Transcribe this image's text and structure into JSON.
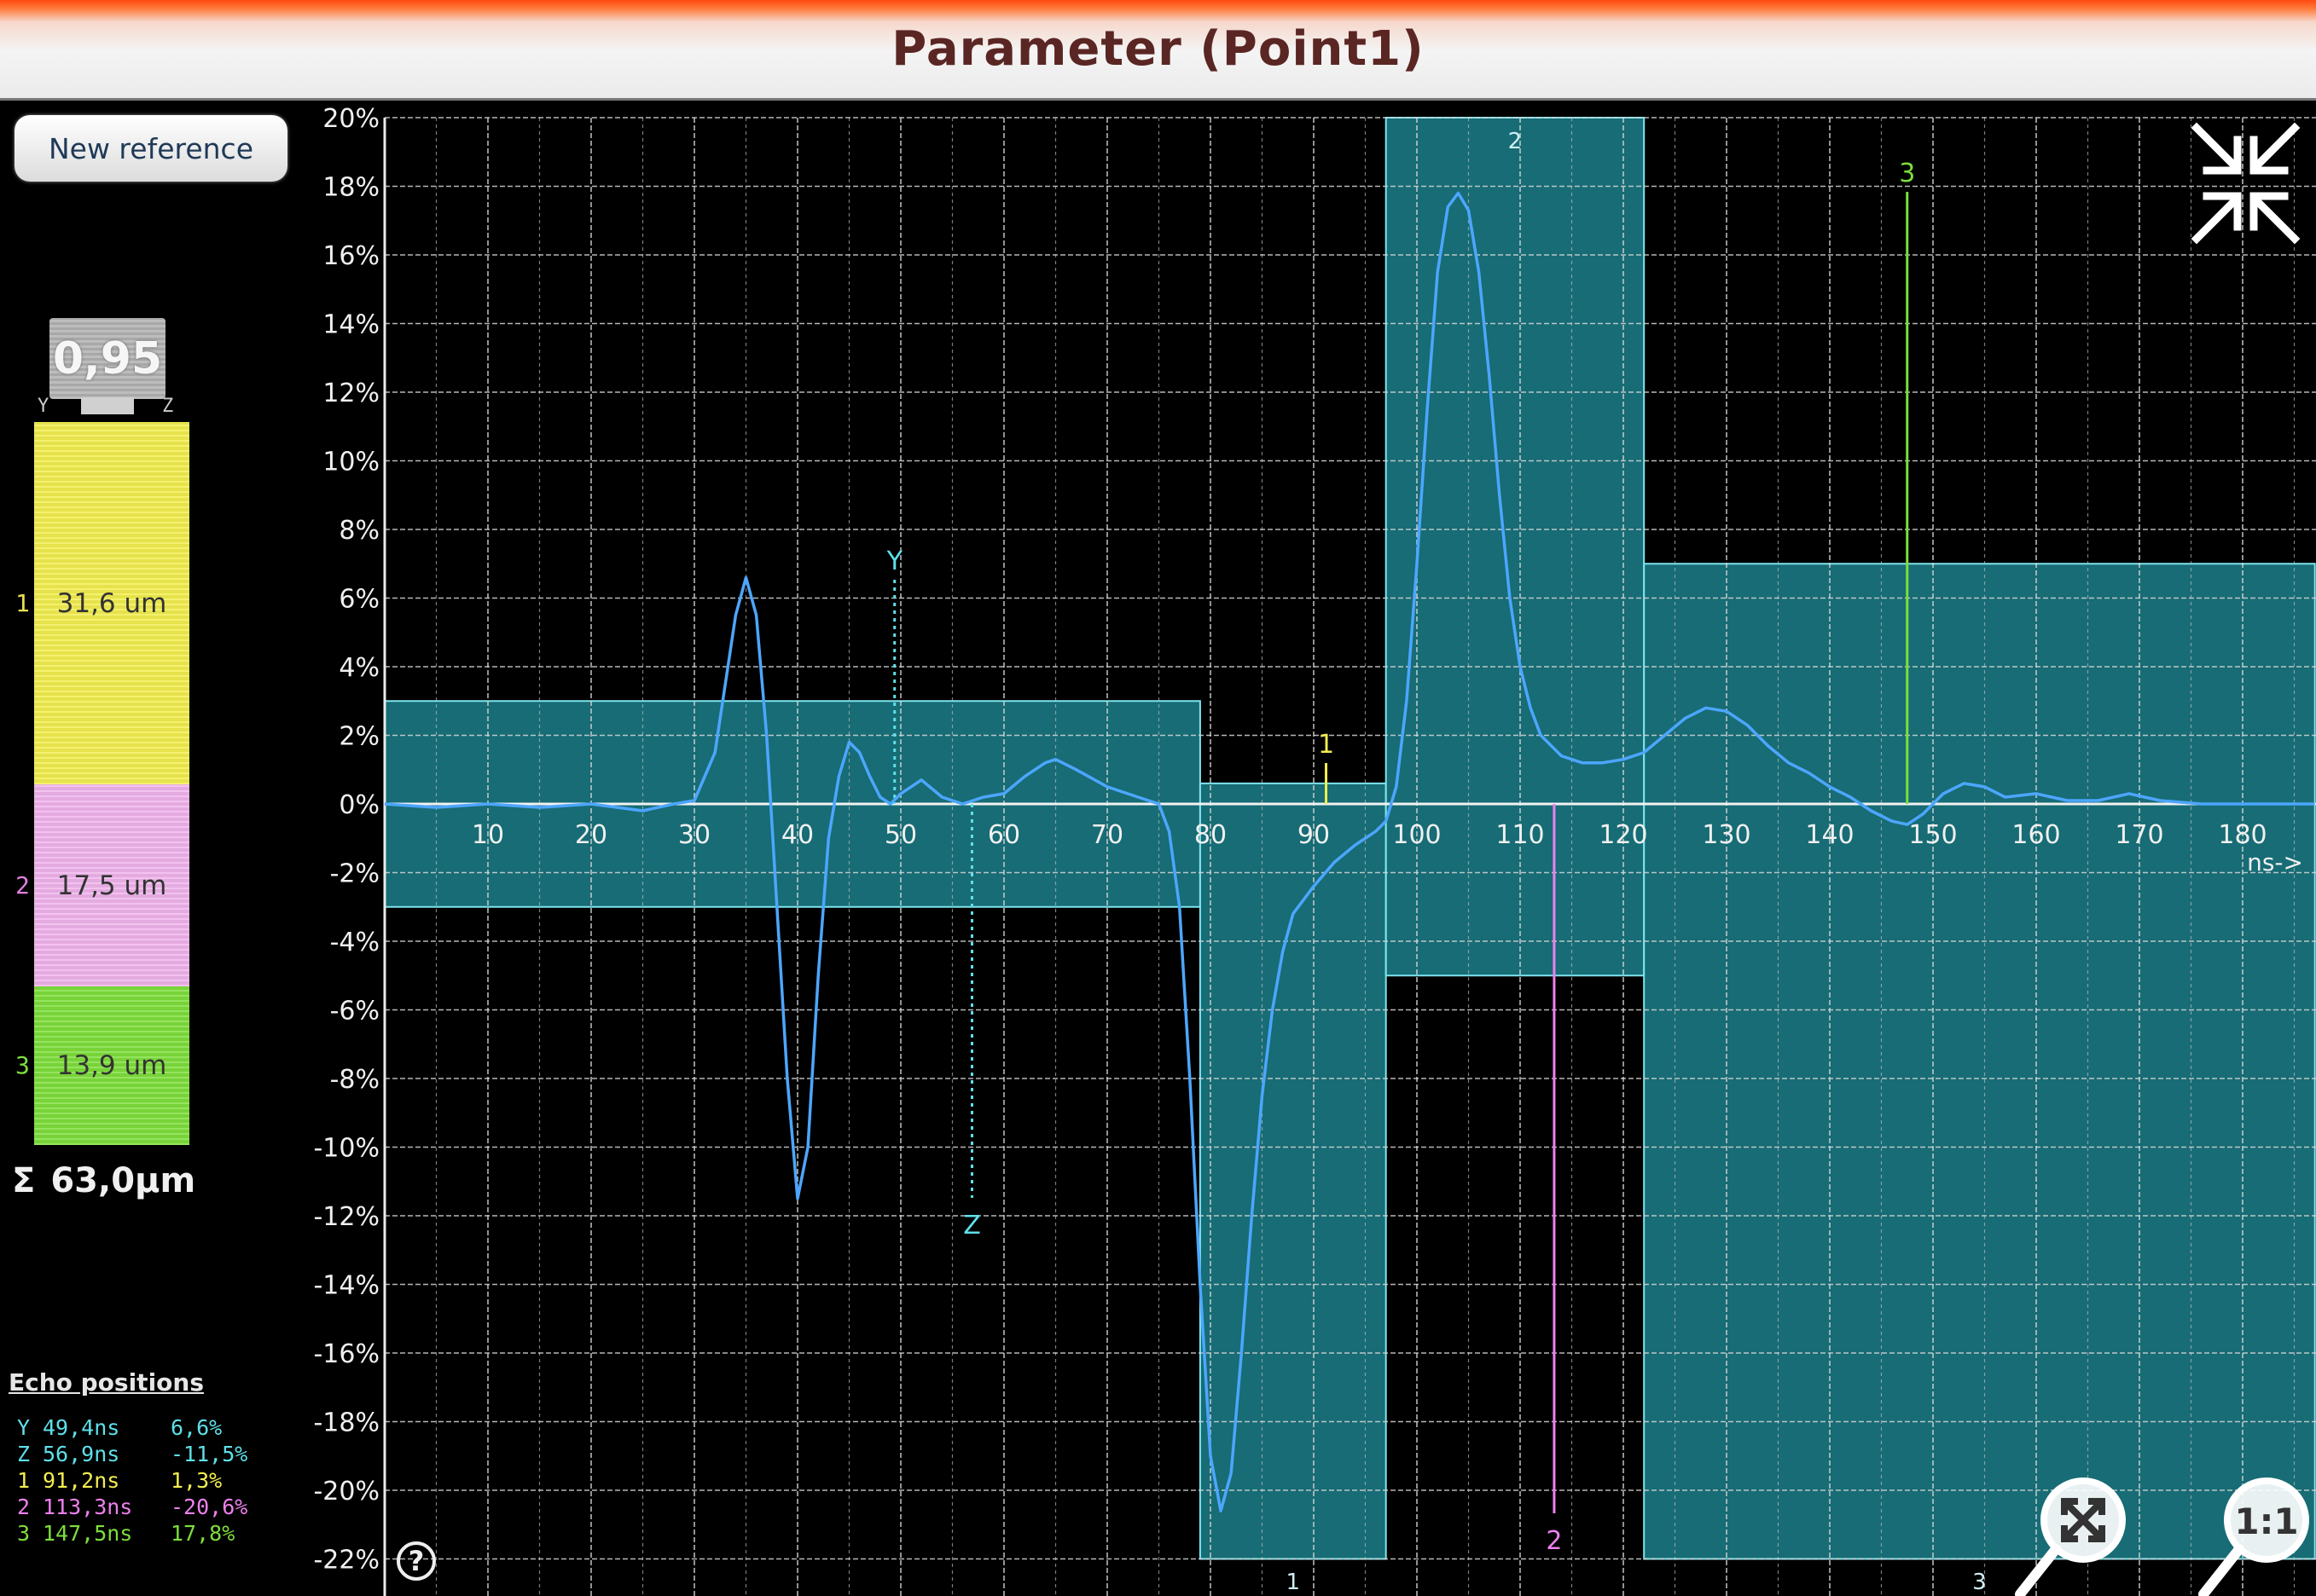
{
  "title": "Parameter (Point1)",
  "new_reference_label": "New reference",
  "ratio": {
    "value": "0,95",
    "left_label": "Y",
    "right_label": "Z"
  },
  "layers": [
    {
      "num": "1",
      "label": "31,6 um",
      "color": "#f2ee50",
      "num_color": "#e8e050"
    },
    {
      "num": "2",
      "label": "17,5 um",
      "color": "#f0b4ec",
      "num_color": "#e080e0"
    },
    {
      "num": "3",
      "label": "13,9 um",
      "color": "#7ede3c",
      "num_color": "#7ede3c"
    }
  ],
  "sum": {
    "symbol": "Σ",
    "value": "63,0µm"
  },
  "echo": {
    "title": "Echo positions",
    "rows": [
      {
        "id": "Y",
        "time": "49,4ns",
        "amp": "6,6%",
        "color": "#5ee0ea"
      },
      {
        "id": "Z",
        "time": "56,9ns",
        "amp": "-11,5%",
        "color": "#5ee0ea"
      },
      {
        "id": "1",
        "time": "91,2ns",
        "amp": "1,3%",
        "color": "#f2ee50"
      },
      {
        "id": "2",
        "time": "113,3ns",
        "amp": "-20,6%",
        "color": "#ee80ee"
      },
      {
        "id": "3",
        "time": "147,5ns",
        "amp": "17,8%",
        "color": "#7ede3c"
      }
    ]
  },
  "chart_data": {
    "type": "line",
    "xlabel": "ns->",
    "xlim": [
      0,
      187
    ],
    "ylim": [
      -22,
      20
    ],
    "x_ticks": [
      10,
      20,
      30,
      40,
      50,
      60,
      70,
      80,
      90,
      100,
      110,
      120,
      130,
      140,
      150,
      160,
      170,
      180
    ],
    "y_ticks": [
      {
        "v": 20,
        "label": "20%"
      },
      {
        "v": 18,
        "label": "18%"
      },
      {
        "v": 16,
        "label": "16%"
      },
      {
        "v": 14,
        "label": "14%"
      },
      {
        "v": 12,
        "label": "12%"
      },
      {
        "v": 10,
        "label": "10%"
      },
      {
        "v": 8,
        "label": "8%"
      },
      {
        "v": 6,
        "label": "6%"
      },
      {
        "v": 4,
        "label": "4%"
      },
      {
        "v": 2,
        "label": "2%"
      },
      {
        "v": 0,
        "label": "0%"
      },
      {
        "v": -2,
        "label": "-2%"
      },
      {
        "v": -4,
        "label": "-4%"
      },
      {
        "v": -6,
        "label": "-6%"
      },
      {
        "v": -8,
        "label": "-8%"
      },
      {
        "v": -10,
        "label": "-10%"
      },
      {
        "v": -12,
        "label": "-12%"
      },
      {
        "v": -14,
        "label": "-14%"
      },
      {
        "v": -16,
        "label": "-16%"
      },
      {
        "v": -18,
        "label": "-18%"
      },
      {
        "v": -20,
        "label": "-20%"
      },
      {
        "v": -22,
        "label": "-22%"
      }
    ],
    "grid": true,
    "gates": [
      {
        "x0": 0,
        "x1": 79,
        "y0": -3,
        "y1": 3,
        "label": ""
      },
      {
        "x0": 79,
        "x1": 97,
        "y0": -22,
        "y1": 0.6,
        "label": "1"
      },
      {
        "x0": 97,
        "x1": 122,
        "y0": -5,
        "y1": 20,
        "label": "2"
      },
      {
        "x0": 122,
        "x1": 187,
        "y0": -22,
        "y1": 7,
        "label": "3"
      }
    ],
    "markers": [
      {
        "label": "Y",
        "x": 49.4,
        "y_top": 6.5,
        "y_bottom": 0,
        "color": "#5ee0ea",
        "dashed": true,
        "label_pos": "top"
      },
      {
        "label": "Z",
        "x": 56.9,
        "y_top": 0,
        "y_bottom": -11.5,
        "color": "#5ee0ea",
        "dashed": true,
        "label_pos": "bottom"
      },
      {
        "label": "1",
        "x": 91.2,
        "y_top": 1.3,
        "y_bottom": 0,
        "color": "#f2ee50",
        "dashed": false,
        "label_pos": "top"
      },
      {
        "label": "2",
        "x": 113.3,
        "y_top": 0,
        "y_bottom": -20.6,
        "color": "#ee80ee",
        "dashed": false,
        "label_pos": "bottom"
      },
      {
        "label": "3",
        "x": 147.5,
        "y_top": 17.8,
        "y_bottom": 0,
        "color": "#7ede3c",
        "dashed": false,
        "label_pos": "top"
      }
    ],
    "series": [
      {
        "color": "#4da6ff",
        "points": [
          [
            0,
            0
          ],
          [
            5,
            -0.1
          ],
          [
            10,
            0
          ],
          [
            15,
            -0.1
          ],
          [
            20,
            0
          ],
          [
            25,
            -0.2
          ],
          [
            28,
            0
          ],
          [
            30,
            0.1
          ],
          [
            32,
            1.5
          ],
          [
            34,
            5.5
          ],
          [
            35,
            6.6
          ],
          [
            36,
            5.5
          ],
          [
            37,
            2
          ],
          [
            38,
            -3
          ],
          [
            39,
            -8
          ],
          [
            40,
            -11.5
          ],
          [
            41,
            -10
          ],
          [
            42,
            -5
          ],
          [
            43,
            -1
          ],
          [
            44,
            0.8
          ],
          [
            45,
            1.8
          ],
          [
            46,
            1.5
          ],
          [
            47,
            0.8
          ],
          [
            48,
            0.2
          ],
          [
            49,
            0
          ],
          [
            50,
            0.3
          ],
          [
            52,
            0.7
          ],
          [
            54,
            0.2
          ],
          [
            56,
            0
          ],
          [
            58,
            0.2
          ],
          [
            60,
            0.3
          ],
          [
            62,
            0.8
          ],
          [
            64,
            1.2
          ],
          [
            65,
            1.3
          ],
          [
            67,
            1.0
          ],
          [
            70,
            0.5
          ],
          [
            73,
            0.2
          ],
          [
            75,
            0
          ],
          [
            76,
            -0.8
          ],
          [
            77,
            -3
          ],
          [
            78,
            -8
          ],
          [
            79,
            -14
          ],
          [
            80,
            -19
          ],
          [
            81,
            -20.6
          ],
          [
            82,
            -19.5
          ],
          [
            83,
            -16
          ],
          [
            84,
            -12
          ],
          [
            85,
            -8.5
          ],
          [
            86,
            -6
          ],
          [
            87,
            -4.3
          ],
          [
            88,
            -3.2
          ],
          [
            90,
            -2.4
          ],
          [
            92,
            -1.7
          ],
          [
            94,
            -1.2
          ],
          [
            96,
            -0.8
          ],
          [
            97,
            -0.5
          ],
          [
            98,
            0.5
          ],
          [
            99,
            3
          ],
          [
            100,
            7
          ],
          [
            101,
            11.5
          ],
          [
            102,
            15.5
          ],
          [
            103,
            17.4
          ],
          [
            104,
            17.8
          ],
          [
            105,
            17.3
          ],
          [
            106,
            15.5
          ],
          [
            107,
            12.5
          ],
          [
            108,
            9
          ],
          [
            109,
            6
          ],
          [
            110,
            4
          ],
          [
            111,
            2.8
          ],
          [
            112,
            2
          ],
          [
            114,
            1.4
          ],
          [
            116,
            1.2
          ],
          [
            118,
            1.2
          ],
          [
            120,
            1.3
          ],
          [
            122,
            1.5
          ],
          [
            124,
            2
          ],
          [
            126,
            2.5
          ],
          [
            128,
            2.8
          ],
          [
            130,
            2.7
          ],
          [
            132,
            2.3
          ],
          [
            134,
            1.7
          ],
          [
            136,
            1.2
          ],
          [
            138,
            0.9
          ],
          [
            140,
            0.5
          ],
          [
            142,
            0.2
          ],
          [
            144,
            -0.2
          ],
          [
            146,
            -0.5
          ],
          [
            147.5,
            -0.6
          ],
          [
            149,
            -0.3
          ],
          [
            151,
            0.3
          ],
          [
            153,
            0.6
          ],
          [
            155,
            0.5
          ],
          [
            157,
            0.2
          ],
          [
            160,
            0.3
          ],
          [
            163,
            0.1
          ],
          [
            166,
            0.1
          ],
          [
            169,
            0.3
          ],
          [
            172,
            0.1
          ],
          [
            176,
            0
          ],
          [
            180,
            0
          ],
          [
            187,
            0
          ]
        ]
      }
    ]
  },
  "icons": {
    "help": "?",
    "zoom_fit": "zoom-fit-icon",
    "zoom_1to1": "1:1",
    "collapse": "collapse-icon"
  }
}
